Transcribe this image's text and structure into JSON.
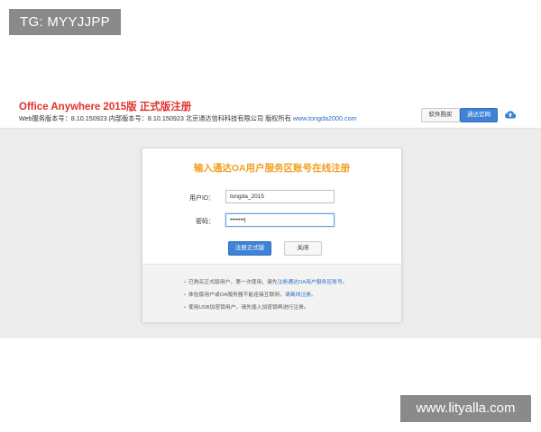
{
  "watermarks": {
    "top": "TG: MYYJJPP",
    "bottom": "www.lityalla.com"
  },
  "header": {
    "title": "Office Anywhere 2015版 正式版注册",
    "version_text": "Web服务版本号：8.10.150923  内部版本号：8.10.150923  北京通达信科科技有限公司 版权所有",
    "site_link": "www.tongda2000.com",
    "buy_button": "软件购买",
    "site_button": "通达官网"
  },
  "form": {
    "title": "输入通达OA用户服务区账号在线注册",
    "user_label": "用户ID：",
    "user_value": "tongda_2015",
    "password_label": "密码：",
    "password_value": "•••••••|",
    "register_button": "注册正式版",
    "close_button": "关闭"
  },
  "notes": [
    {
      "bullet": "•",
      "text": "已购买正式版用户，第一次使用，请先",
      "link": "注册通达OA用户服务区账号。",
      "suffix": ""
    },
    {
      "bullet": "•",
      "text": "体验版用户或OA服务器不能连接互联网，",
      "link": "请离线注册",
      "suffix": "。"
    },
    {
      "bullet": "•",
      "text": "使用USB加密锁用户，请先插入加密锁再进行注册。",
      "link": "",
      "suffix": ""
    }
  ],
  "colors": {
    "title_red": "#e0312a",
    "form_title_orange": "#f0a020",
    "primary_blue": "#3f82d6",
    "link_blue": "#2a6fbf"
  }
}
